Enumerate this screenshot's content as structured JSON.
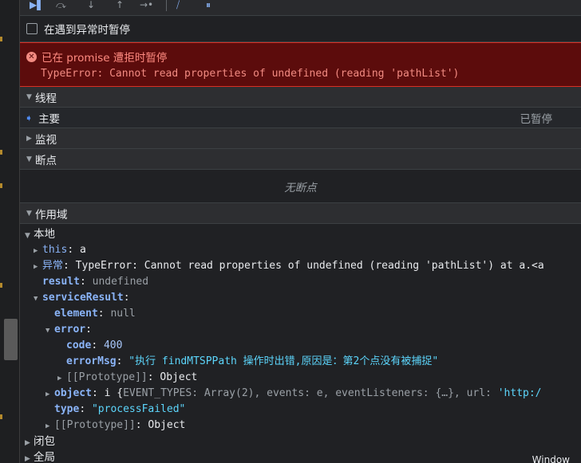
{
  "checkbox": {
    "label": "在遇到异常时暂停"
  },
  "error": {
    "title": "已在 promise 遭拒时暂停",
    "message": "TypeError: Cannot read properties of undefined (reading 'pathList')"
  },
  "threads": {
    "header": "线程",
    "main_label": "主要",
    "status": "已暂停"
  },
  "watch": {
    "header": "监视"
  },
  "breakpoints": {
    "header": "断点",
    "empty": "无断点"
  },
  "scope": {
    "header": "作用域",
    "local": "本地",
    "this_key": "this",
    "this_val": "a",
    "exc_key": "异常",
    "exc_val": "TypeError: Cannot read properties of undefined (reading 'pathList') at a.<a",
    "result_key": "result",
    "result_val": "undefined",
    "sr_key": "serviceResult",
    "element_key": "element",
    "element_val": "null",
    "error_key": "error",
    "code_key": "code",
    "code_val": "400",
    "msg_key": "errorMsg",
    "msg_val": "\"执行 findMTSPPath 操作时出错,原因是：第2个点没有被捕捉\"",
    "proto_key": "[[Prototype]]",
    "proto_val": "Object",
    "object_key": "object",
    "object_val_pre": "i {",
    "object_val_rest": "EVENT_TYPES: Array(2), events: e, eventListeners: {…}, url: ",
    "object_url": "'http:/",
    "type_key": "type",
    "type_val": "\"processFailed\"",
    "closure": "闭包",
    "global": "全局",
    "global_val": "Window"
  },
  "colors": {
    "accent": "#8ab4f8",
    "error_bg": "#5c0c0c",
    "error_text": "#f28b82",
    "string": "#5cd5fb"
  }
}
